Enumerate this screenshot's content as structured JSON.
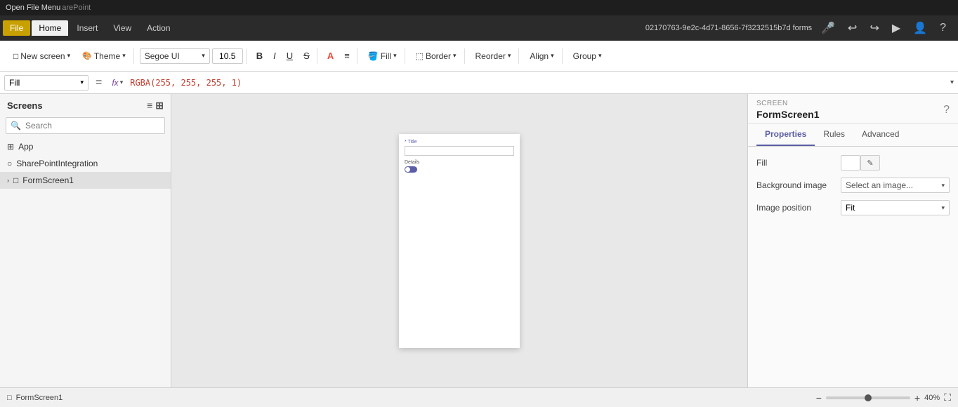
{
  "titlebar": {
    "text": "Open File Menu",
    "sharepoint": "arePoint"
  },
  "menubar": {
    "file_label": "File",
    "home_label": "Home",
    "insert_label": "Insert",
    "view_label": "View",
    "action_label": "Action",
    "doc_id": "02170763-9e2c-4d71-8656-7f3232515b7d forms"
  },
  "ribbon": {
    "new_screen_label": "New screen",
    "theme_label": "Theme",
    "font_name": "Segoe UI",
    "font_size": "10.5",
    "bold_label": "B",
    "italic_label": "I",
    "underline_label": "U",
    "strikethrough_label": "S",
    "color_label": "A",
    "fill_label": "Fill",
    "border_label": "Border",
    "reorder_label": "Reorder",
    "align_label": "Align",
    "group_label": "Group"
  },
  "formula_bar": {
    "property": "Fill",
    "equals": "=",
    "fx_label": "fx",
    "formula": "RGBA(255, 255, 255, 1)"
  },
  "screens_panel": {
    "title": "Screens",
    "search_placeholder": "Search",
    "items": [
      {
        "name": "App",
        "type": "app",
        "icon": "⊞"
      },
      {
        "name": "SharePointIntegration",
        "type": "integration",
        "icon": "○"
      },
      {
        "name": "FormScreen1",
        "type": "screen",
        "icon": "□",
        "selected": true
      }
    ]
  },
  "canvas": {
    "form_title_label": "* Title",
    "form_details_label": "Details"
  },
  "right_panel": {
    "section_label": "SCREEN",
    "screen_name": "FormScreen1",
    "tabs": [
      {
        "label": "Properties",
        "active": true
      },
      {
        "label": "Rules",
        "active": false
      },
      {
        "label": "Advanced",
        "active": false
      }
    ],
    "properties": {
      "fill_label": "Fill",
      "background_image_label": "Background image",
      "background_image_value": "Select an image...",
      "image_position_label": "Image position",
      "image_position_value": "Fit"
    }
  },
  "status_bar": {
    "screen_icon": "□",
    "screen_name": "FormScreen1",
    "zoom_minus": "−",
    "zoom_plus": "+",
    "zoom_value": "40",
    "zoom_unit": "%"
  },
  "icons": {
    "search": "🔍",
    "list_view": "≡",
    "grid_view": "⊞",
    "help": "?",
    "undo": "↩",
    "redo": "↪",
    "play": "▶",
    "user": "👤",
    "question": "?",
    "chevron_down": "▾",
    "chevron_right": "›",
    "fx": "fx",
    "edit": "✎",
    "expand": "⛶"
  }
}
